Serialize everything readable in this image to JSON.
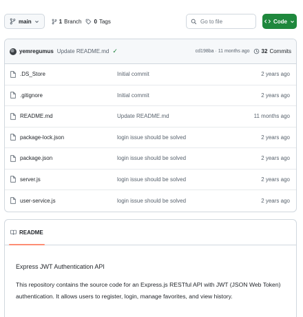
{
  "toolbar": {
    "branch_label": "main",
    "branches_count": "1",
    "branches_label": "Branch",
    "tags_count": "0",
    "tags_label": "Tags",
    "search_placeholder": "Go to file",
    "code_label": "Code"
  },
  "latest_commit": {
    "author": "yemregumus",
    "message": "Update README.md",
    "hash_time": "cd198ba · 11 months ago",
    "commits_count": "32",
    "commits_label": "Commits"
  },
  "files": [
    {
      "name": ".DS_Store",
      "message": "Initial commit",
      "age": "2 years ago"
    },
    {
      "name": ".gitignore",
      "message": "Initial commit",
      "age": "2 years ago"
    },
    {
      "name": "README.md",
      "message": "Update README.md",
      "age": "11 months ago"
    },
    {
      "name": "package-lock.json",
      "message": "login issue should be solved",
      "age": "2 years ago"
    },
    {
      "name": "package.json",
      "message": "login issue should be solved",
      "age": "2 years ago"
    },
    {
      "name": "server.js",
      "message": "login issue should be solved",
      "age": "2 years ago"
    },
    {
      "name": "user-service.js",
      "message": "login issue should be solved",
      "age": "2 years ago"
    }
  ],
  "readme": {
    "tab_label": "README",
    "title": "Express JWT Authentication API",
    "description": "This repository contains the source code for an Express.js RESTful API with JWT (JSON Web Token) authentication. It allows users to register, login, manage favorites, and view history."
  },
  "colors": {
    "code_button": "#1f883d",
    "check": "#1a7f37",
    "tab_underline": "#fd8c73"
  }
}
